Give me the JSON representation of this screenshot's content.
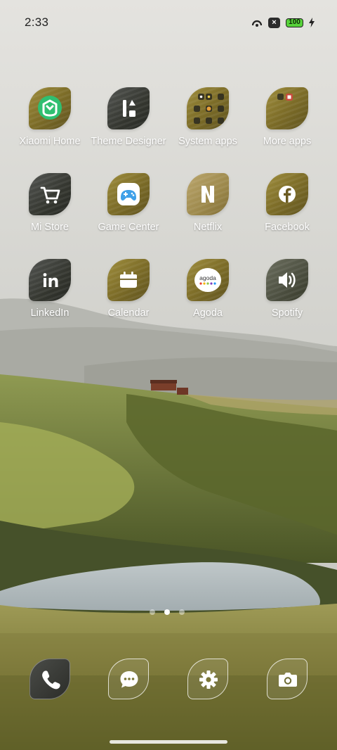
{
  "status_bar": {
    "time": "2:33",
    "battery": "100"
  },
  "apps": [
    {
      "label": "Xiaomi Home",
      "icon": "xiaomi-home-icon"
    },
    {
      "label": "Theme Designer",
      "icon": "theme-designer-icon"
    },
    {
      "label": "System apps",
      "icon": "folder-icon"
    },
    {
      "label": "More apps",
      "icon": "folder-icon"
    },
    {
      "label": "Mi Store",
      "icon": "cart-icon"
    },
    {
      "label": "Game Center",
      "icon": "gamepad-icon"
    },
    {
      "label": "Netflix",
      "icon": "netflix-icon"
    },
    {
      "label": "Facebook",
      "icon": "facebook-icon"
    },
    {
      "label": "LinkedIn",
      "icon": "linkedin-icon"
    },
    {
      "label": "Calendar",
      "icon": "calendar-icon"
    },
    {
      "label": "Agoda",
      "icon": "agoda-icon",
      "logo_text": "agoda"
    },
    {
      "label": "Spotify",
      "icon": "speaker-icon"
    }
  ],
  "page_indicator": {
    "count": 3,
    "active": 2
  },
  "dock": [
    {
      "name": "phone",
      "icon": "phone-icon"
    },
    {
      "name": "messages",
      "icon": "message-icon"
    },
    {
      "name": "settings",
      "icon": "gear-icon"
    },
    {
      "name": "camera",
      "icon": "camera-icon"
    }
  ],
  "colors": {
    "label_text": "#ffffff",
    "battery_fill": "#57d23a",
    "xiaomi_green": "#2fbf71",
    "game_center_blue": "#3fa0e8"
  }
}
